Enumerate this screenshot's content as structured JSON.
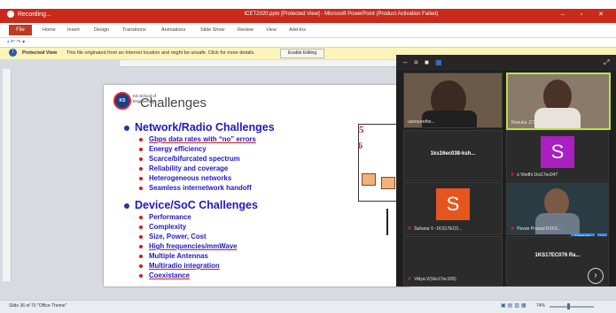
{
  "recorder": {
    "label": "Recording..."
  },
  "window": {
    "title": "ICET2020.pptx [Protected View] - Microsoft PowerPoint (Product Activation Failed)",
    "controls": "– ▫ ✕"
  },
  "ribbon": {
    "file": "File",
    "tabs": [
      "Home",
      "Insert",
      "Design",
      "Transitions",
      "Animations",
      "Slide Show",
      "Review",
      "View",
      "Add-Ins"
    ]
  },
  "quick_access": "▪ ↶ ↷ ▾",
  "protected_view": {
    "label": "Protected View",
    "message": "This file originated from an Internet location and might be unsafe. Click for more details.",
    "button": "Enable Editing"
  },
  "slide": {
    "logo_text": "KS",
    "college": "KS School of Engineering",
    "title": "Challenges",
    "sections": [
      {
        "heading": "Network/Radio Challenges",
        "items": [
          "Gbps data rates with “no” errors",
          "Energy efficiency",
          "Scarce/bifurcated spectrum",
          "Reliability and coverage",
          "Heterogeneous networks",
          "Seamless internetwork handoff"
        ]
      },
      {
        "heading": "Device/SoC Challenges",
        "items": [
          "Performance",
          "Complexity",
          "Size, Power, Cost",
          "High frequencies/mmWave",
          "Multiple Antennas",
          "Multiradio integration",
          "Coexistance"
        ]
      }
    ],
    "diagram": {
      "num1": "5",
      "num2": "6"
    }
  },
  "zoom": {
    "tiles": [
      {
        "name": "usersurethe...",
        "type": "video",
        "bg": "#6b5a48"
      },
      {
        "name": "Renuka .CT",
        "type": "video",
        "bg": "#8a7a6a"
      },
      {
        "name": "1ks16ec038-ksh...",
        "type": "text"
      },
      {
        "name": "s Vindhi 1ks17ec047",
        "type": "avatar",
        "letter": "S",
        "color": "#a91fc0"
      },
      {
        "name": "Sahana V -1KS17EC0...",
        "type": "avatar",
        "letter": "S",
        "color": "#e5561f"
      },
      {
        "name": "Pavan Prasad R1KS...",
        "type": "video",
        "bg": "#2a3b42"
      },
      {
        "name": "Vidya.V(1ks17ec105)",
        "type": "empty"
      },
      {
        "name": "1KS17EC076 Ra...",
        "type": "text"
      }
    ],
    "unmute": "Unmute",
    "more": "···",
    "next": "›"
  },
  "statusbar": {
    "slide_info": "Slide 36 of 70   \"Office Theme\"",
    "zoom": "74%"
  }
}
